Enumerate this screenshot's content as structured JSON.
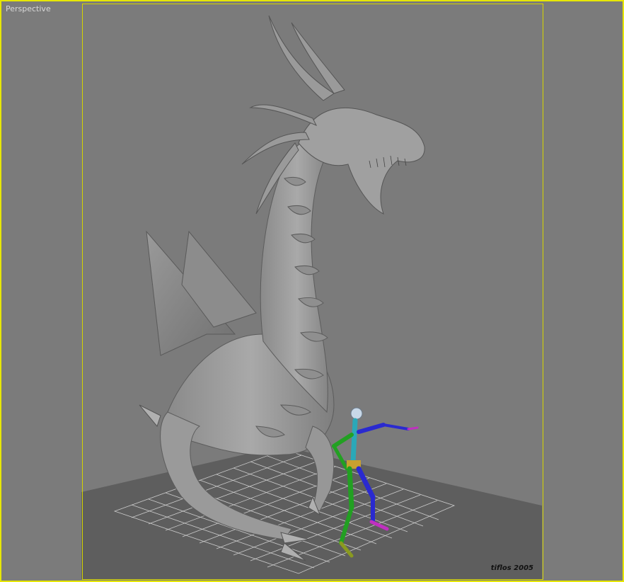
{
  "viewport": {
    "label": "Perspective",
    "credit": "tiflos 2005",
    "border_color": "#e6e600",
    "background_color": "#7b7b7b"
  },
  "scene": {
    "objects": [
      "ground-plane",
      "grid",
      "dragon-model",
      "biped-skeleton"
    ],
    "skeleton_colors": {
      "head": "#c8d8e8",
      "spine": "#2aa8b8",
      "left_limbs": "#22a022",
      "right_limbs": "#2a2ad0",
      "pelvis": "#c8a030",
      "hand": "#c030c0"
    }
  }
}
